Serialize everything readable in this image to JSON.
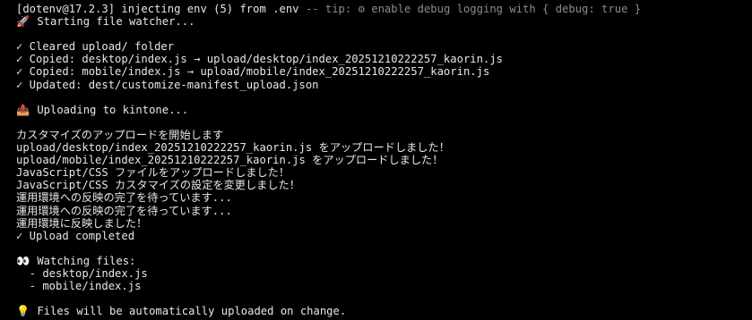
{
  "terminal": {
    "dotenv": {
      "prefix": "[dotenv@17.2.3] injecting env (5) from .env",
      "separator": " -- tip: ",
      "gear_icon": "⚙",
      "tip": " enable debug logging with { debug: true }"
    },
    "starting": {
      "icon": "🚀",
      "text": " Starting file watcher..."
    },
    "setup_lines": [
      "✓ Cleared upload/ folder",
      "✓ Copied: desktop/index.js → upload/desktop/index_20251210222257_kaorin.js",
      "✓ Copied: mobile/index.js → upload/mobile/index_20251210222257_kaorin.js",
      "✓ Updated: dest/customize-manifest_upload.json"
    ],
    "uploading": {
      "icon": "📤",
      "text": " Uploading to kintone..."
    },
    "upload_lines": [
      "カスタマイズのアップロードを開始します",
      "upload/desktop/index_20251210222257_kaorin.js をアップロードしました！",
      "upload/mobile/index_20251210222257_kaorin.js をアップロードしました！",
      "JavaScript/CSS ファイルをアップロードしました！",
      "JavaScript/CSS カスタマイズの設定を変更しました！",
      "運用環境への反映の完了を待っています...",
      "運用環境への反映の完了を待っています...",
      "運用環境に反映しました！",
      "✓ Upload completed"
    ],
    "watching": {
      "icon": "👀",
      "text": " Watching files:",
      "files": [
        "  - desktop/index.js",
        "  - mobile/index.js"
      ]
    },
    "footer": {
      "icon": "💡",
      "text": " Files will be automatically uploaded on change."
    }
  }
}
